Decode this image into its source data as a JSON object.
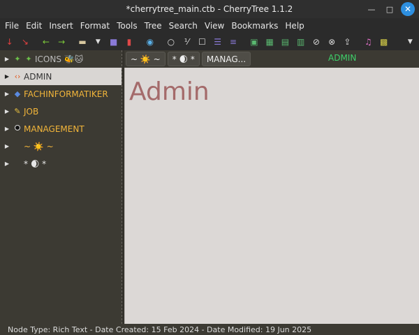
{
  "window": {
    "title": "*cherrytree_main.ctb - CherryTree 1.1.2",
    "minimize_icon": "minimize-icon",
    "maximize_icon": "maximize-icon",
    "close_icon": "close-icon"
  },
  "menu": [
    "File",
    "Edit",
    "Insert",
    "Format",
    "Tools",
    "Tree",
    "Search",
    "View",
    "Bookmarks",
    "Help"
  ],
  "toolbar": {
    "icons": [
      "add-node-icon",
      "add-subnode-icon",
      "go-back-icon",
      "go-forward-icon",
      "open-file-icon",
      "dropdown-arrow-icon",
      "save-icon",
      "export-pdf-icon",
      "find-icon",
      "bullet-list-icon",
      "numbered-list-icon",
      "todo-list-icon",
      "toc-icon",
      "underline-list-icon",
      "insert-image-icon",
      "insert-table-icon",
      "insert-codebox-icon",
      "insert-anchor-icon",
      "insert-link-icon",
      "link-icon",
      "export-icon",
      "color-fg-icon",
      "color-bg-icon",
      "toolbar-more-icon"
    ]
  },
  "tree": {
    "items": [
      {
        "label": "ICONS 🐝🐱",
        "icon": "leaf",
        "prefix": "🧩🧩",
        "muted": true
      },
      {
        "label": "ADMIN",
        "icon": "code",
        "prefix": "‹›",
        "selected": true
      },
      {
        "label": "FACHINFORMATIKER",
        "icon": "gem",
        "prefix": "◆"
      },
      {
        "label": "JOB",
        "icon": "pencil",
        "prefix": "✏"
      },
      {
        "label": "MANAGEMENT",
        "icon": "dot",
        "prefix": "●"
      },
      {
        "label": "~ ☀️ ~",
        "icon": "none",
        "prefix": ""
      },
      {
        "label": "* 🌒 *",
        "icon": "none",
        "prefix": ""
      }
    ]
  },
  "tabs": [
    {
      "label": "~ ☀️ ~"
    },
    {
      "label": "* 🌒 *"
    },
    {
      "label": "MANAG..."
    }
  ],
  "node_title": "ADMIN",
  "editor": {
    "heading": "Admin"
  },
  "status": {
    "text": "Node Type: Rich Text  -  Date Created: 15 Feb 2024  -  Date Modified: 19 Jun 2025"
  },
  "colors": {
    "accent_green": "#3ecf6a",
    "tree_label": "#f2b53a",
    "heading": "#a46a6a"
  }
}
